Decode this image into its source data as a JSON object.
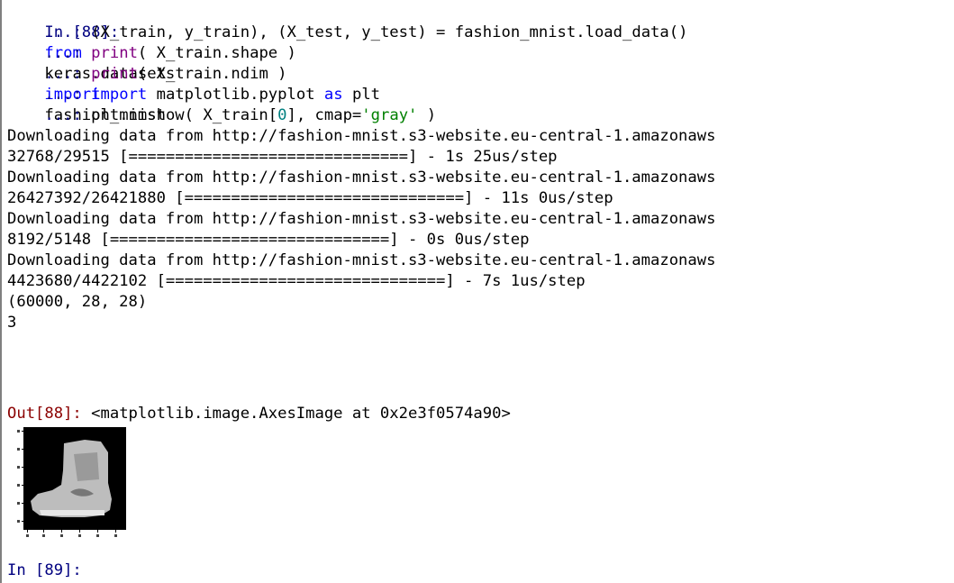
{
  "cell_in_88": {
    "prompt": "In [88]:",
    "line1": {
      "kw1": "from",
      "mod": "keras.datasets",
      "kw2": "import",
      "name": "fashion_mnist"
    },
    "cont": "...:",
    "line2": "(X_train, y_train), (X_test, y_test) = fashion_mnist.load_data()",
    "line3": {
      "fn": "print",
      "arg": "( X_train.shape )"
    },
    "line4": {
      "fn": "print",
      "arg": "( X_train.ndim )"
    },
    "line5": {
      "kw1": "import",
      "mod": "matplotlib.pyplot",
      "kw2": "as",
      "name": "plt"
    },
    "line6": {
      "pre": "plt.imshow( X_train[",
      "idx": "0",
      "mid": "], cmap=",
      "str": "'gray'",
      "post": " )"
    }
  },
  "output": {
    "lines": [
      "Downloading data from http://fashion-mnist.s3-website.eu-central-1.amazonaws",
      "32768/29515 [==============================] - 1s 25us/step",
      "Downloading data from http://fashion-mnist.s3-website.eu-central-1.amazonaws",
      "26427392/26421880 [==============================] - 11s 0us/step",
      "Downloading data from http://fashion-mnist.s3-website.eu-central-1.amazonaws",
      "8192/5148 [==============================] - 0s 0us/step",
      "Downloading data from http://fashion-mnist.s3-website.eu-central-1.amazonaws",
      "4423680/4422102 [==============================] - 7s 1us/step",
      "(60000, 28, 28)",
      "3"
    ]
  },
  "cell_out_88": {
    "prompt": "Out[88]:",
    "value": " <matplotlib.image.AxesImage at 0x2e3f0574a90>"
  },
  "plot": {
    "image_desc_icon": "ankle-boot-image",
    "cmap": "gray"
  },
  "cell_in_89": {
    "prompt": "In [89]:"
  }
}
